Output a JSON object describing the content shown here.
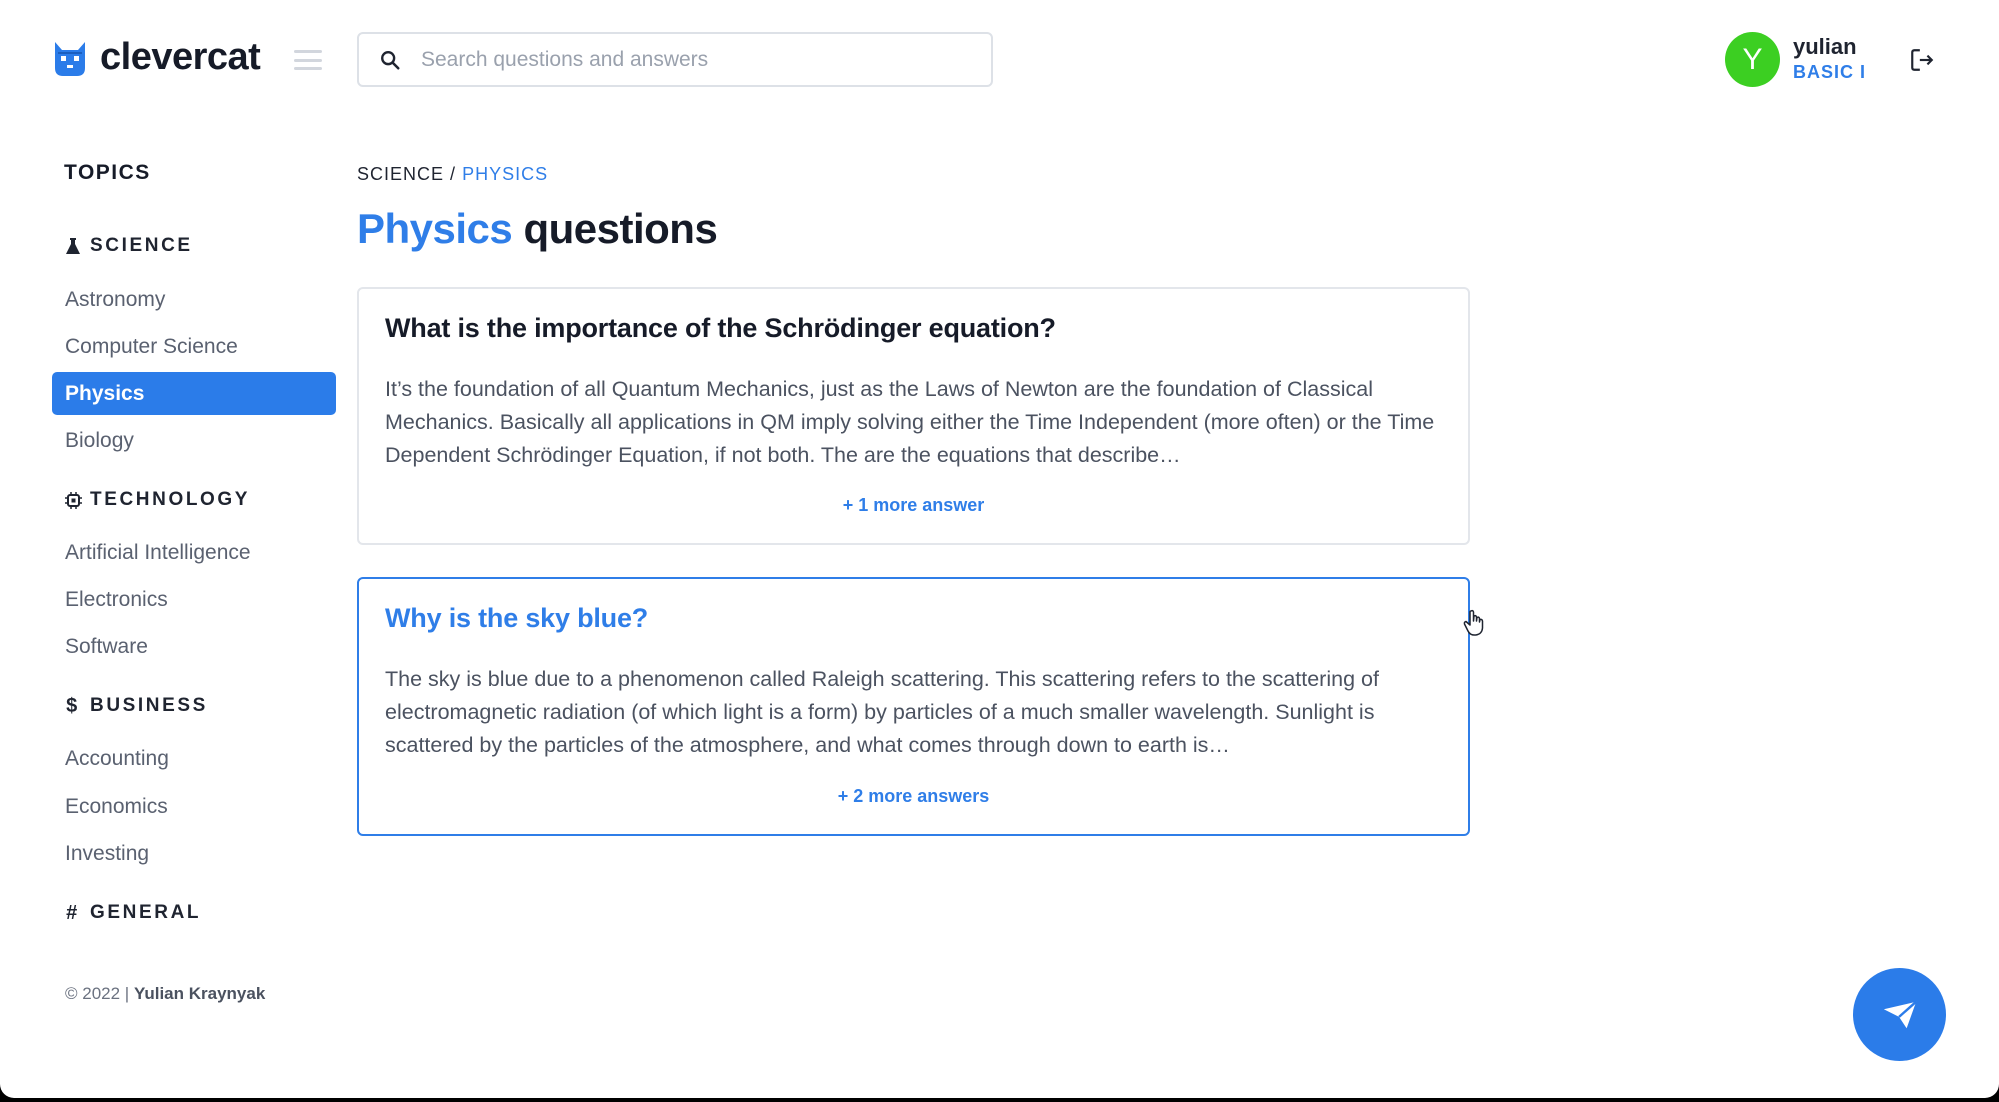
{
  "app": {
    "name": "clevercat"
  },
  "search": {
    "placeholder": "Search questions and answers"
  },
  "user": {
    "initial": "Y",
    "name": "yulian",
    "plan": "BASIC I"
  },
  "sidebar": {
    "title": "TOPICS",
    "categories": [
      {
        "label": "SCIENCE",
        "icon": "flask-icon",
        "items": [
          "Astronomy",
          "Computer Science",
          "Physics",
          "Biology"
        ],
        "active": "Physics"
      },
      {
        "label": "TECHNOLOGY",
        "icon": "chip-icon",
        "items": [
          "Artificial Intelligence",
          "Electronics",
          "Software"
        ]
      },
      {
        "label": "BUSINESS",
        "icon": "dollar-icon",
        "items": [
          "Accounting",
          "Economics",
          "Investing"
        ]
      },
      {
        "label": "GENERAL",
        "icon": "hash-icon",
        "items": []
      }
    ],
    "footer": {
      "copyright": "© 2022 |",
      "author": "Yulian Kraynyak"
    }
  },
  "breadcrumb": {
    "parent": "SCIENCE",
    "separator": "/",
    "current": "PHYSICS"
  },
  "page_title": {
    "highlight": "Physics",
    "rest": "questions"
  },
  "questions": [
    {
      "title": "What is the importance of the Schrödinger equation?",
      "answer": "It’s the foundation of all Quantum Mechanics, just as the Laws of Newton are the foundation of Classical Mechanics. Basically all applications in QM imply solving either the Time Independent (more often) or the Time Dependent Schrödinger Equation, if not both. The are the equations that describe…",
      "more": "+ 1 more answer"
    },
    {
      "title": "Why is the sky blue?",
      "answer": "The sky is blue due to a phenomenon called Raleigh scattering. This scattering refers to the scattering of electromagnetic radiation (of which light is a form) by particles of a much smaller wavelength. Sunlight is scattered by the particles of the atmosphere, and what comes through down to earth is…",
      "more": "+ 2 more answers"
    }
  ],
  "colors": {
    "accent": "#2b7ce9",
    "avatar": "#3ccf22",
    "text": "#1f2430"
  },
  "icons": {
    "logo": "cat-logo-icon",
    "menu": "hamburger-icon",
    "search": "search-icon",
    "logout": "logout-icon",
    "fab": "send-icon",
    "cursor": "hand-cursor-icon"
  }
}
